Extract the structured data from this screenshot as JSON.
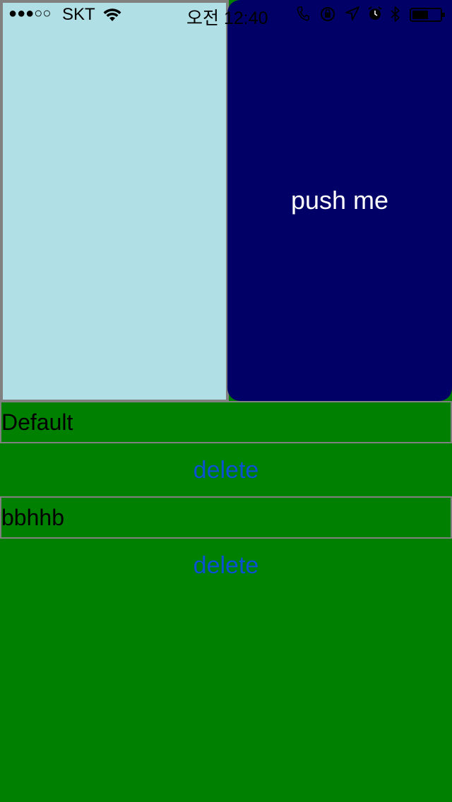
{
  "status_bar": {
    "signal": "●●●○○",
    "carrier": "SKT",
    "time": "오전 12:40",
    "icons": [
      "phone-icon",
      "orientation-lock-icon",
      "location-icon",
      "alarm-icon",
      "bluetooth-icon",
      "battery-icon"
    ]
  },
  "left_panel": {
    "color": "#B0DFE5"
  },
  "push_button": {
    "label": "push me",
    "color": "#000066"
  },
  "rows": [
    {
      "text": "Default",
      "delete_label": "delete"
    },
    {
      "text": "bbhhb",
      "delete_label": "delete"
    }
  ],
  "colors": {
    "background": "#008000",
    "delete_text": "#0B4FD3",
    "border": "#808080"
  }
}
